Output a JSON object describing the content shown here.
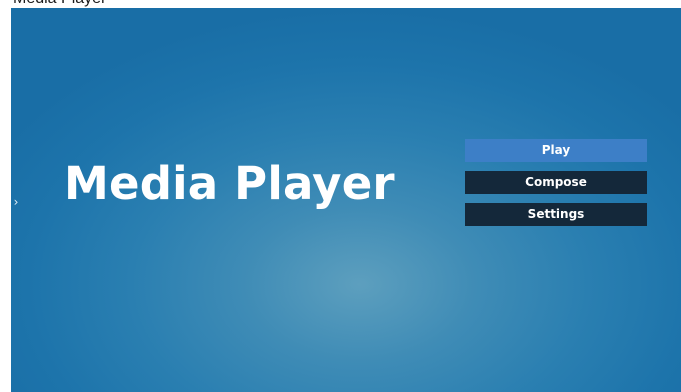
{
  "top_caption": "Media Player",
  "side_nav": {
    "arrow": "›"
  },
  "app": {
    "title": "Media Player"
  },
  "menu": {
    "items": [
      {
        "label": "Play",
        "state": "selected"
      },
      {
        "label": "Compose",
        "state": "normal"
      },
      {
        "label": "Settings",
        "state": "normal"
      }
    ]
  },
  "colors": {
    "background_center": "#5d9fbe",
    "background_edge": "#196ea6",
    "button_selected": "#3d7fc7",
    "button_normal": "#14283a",
    "text": "#ffffff"
  }
}
